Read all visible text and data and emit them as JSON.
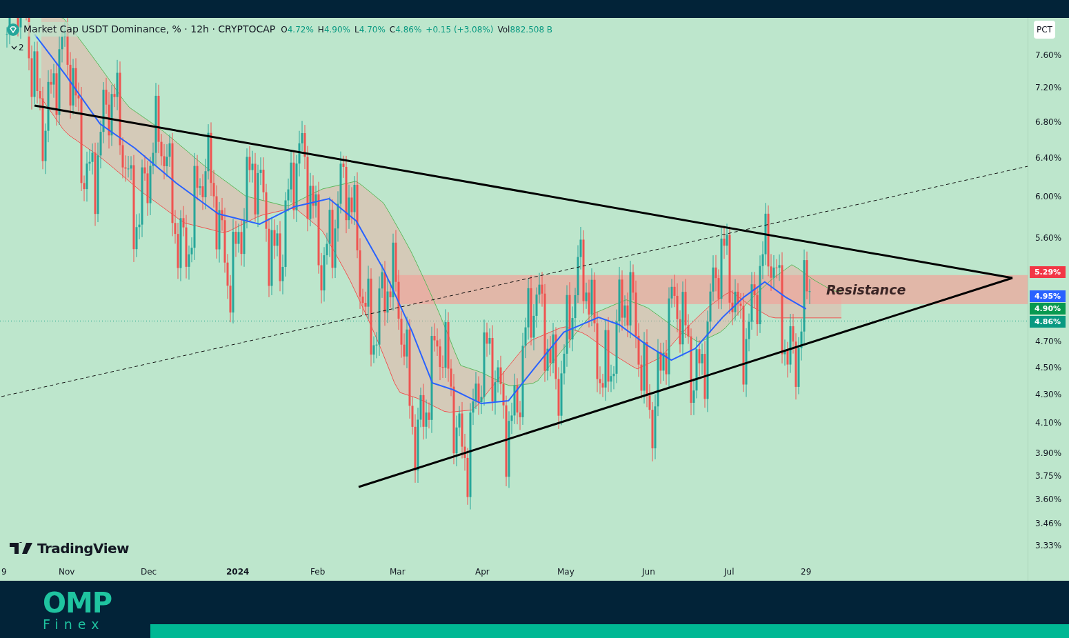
{
  "legend": {
    "title": "Market Cap USDT Dominance, % · 12h · CRYPTOCAP",
    "ohlc": [
      {
        "label": "O",
        "value": "4.72%"
      },
      {
        "label": "H",
        "value": "4.90%"
      },
      {
        "label": "L",
        "value": "4.70%"
      },
      {
        "label": "C",
        "value": "4.86%"
      }
    ],
    "change": "+0.15 (+3.08%)",
    "volume_label": "Vol",
    "volume_value": "882.508 B",
    "indicator_count": "2"
  },
  "scale_button": "PCT",
  "annotation": "Resistance",
  "brand": "TradingView",
  "price_badges": [
    {
      "label": "5.29%",
      "color": "#f23645"
    },
    {
      "label": "4.95%",
      "color": "#2962ff"
    },
    {
      "label": "4.90%",
      "color": "#089950"
    },
    {
      "label": "4.86%",
      "color": "#089981"
    }
  ],
  "price_axis_labels": [
    "7.60%",
    "7.20%",
    "6.80%",
    "6.40%",
    "6.00%",
    "5.60%",
    "4.70%",
    "4.50%",
    "4.30%",
    "4.10%",
    "3.90%",
    "3.75%",
    "3.60%",
    "3.46%",
    "3.33%"
  ],
  "time_axis_labels": [
    "9",
    "Nov",
    "Dec",
    "2024",
    "Feb",
    "Mar",
    "Apr",
    "May",
    "Jun",
    "Jul",
    "29"
  ],
  "footer": {
    "logo_top": "OMP",
    "logo_bottom": "Finex"
  }
}
